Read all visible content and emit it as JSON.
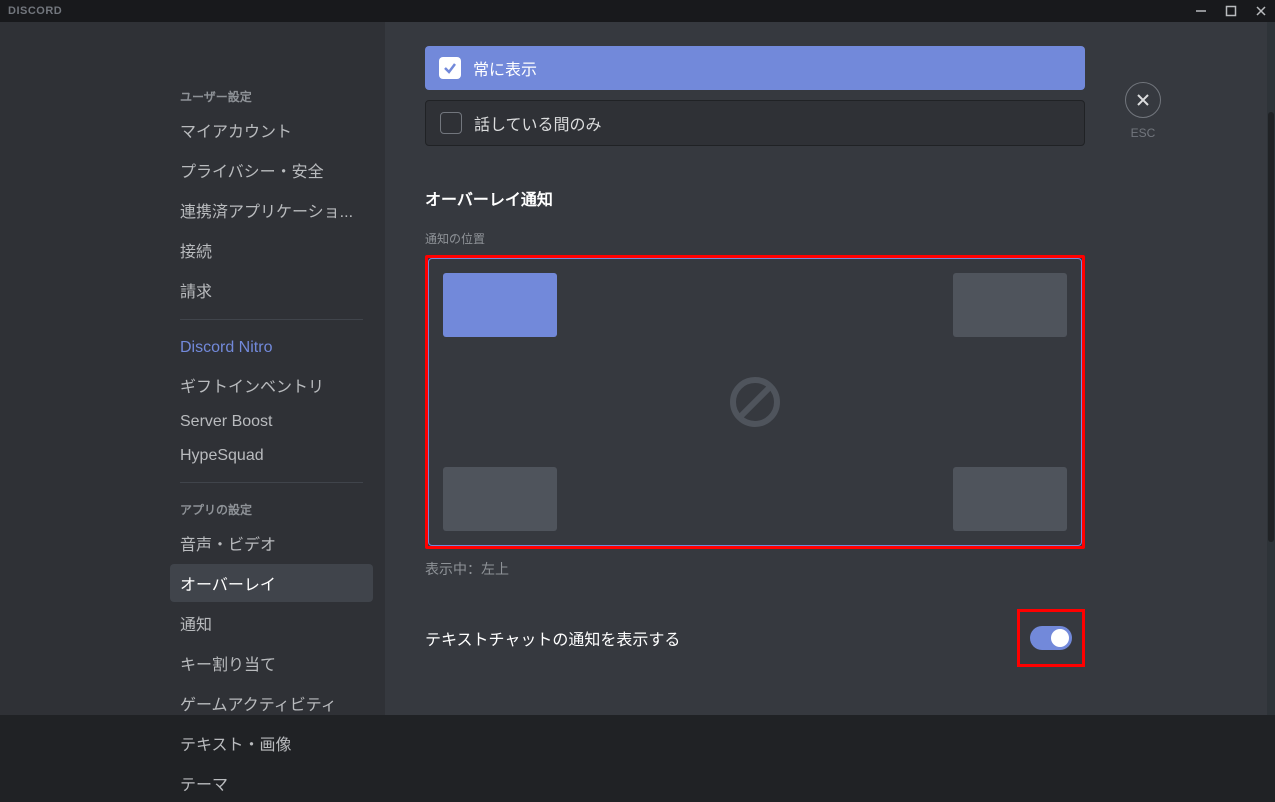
{
  "titlebar": {
    "logo": "DISCORD"
  },
  "close": {
    "label": "ESC"
  },
  "sidebar": {
    "header1": "ユーザー設定",
    "items1": [
      "マイアカウント",
      "プライバシー・安全",
      "連携済アプリケーショ...",
      "接続",
      "請求"
    ],
    "nitro": "Discord Nitro",
    "items2": [
      "ギフトインベントリ",
      "Server Boost",
      "HypeSquad"
    ],
    "header2": "アプリの設定",
    "items3": [
      "音声・ビデオ",
      "オーバーレイ",
      "通知",
      "キー割り当て",
      "ゲームアクティビティ",
      "テキスト・画像",
      "テーマ"
    ]
  },
  "radios": {
    "always": "常に表示",
    "speaking": "話している間のみ"
  },
  "section": {
    "title": "オーバーレイ通知",
    "posLabel": "通知の位置",
    "posStatus": "表示中：左上"
  },
  "toggle": {
    "label": "テキストチャットの通知を表示する"
  }
}
